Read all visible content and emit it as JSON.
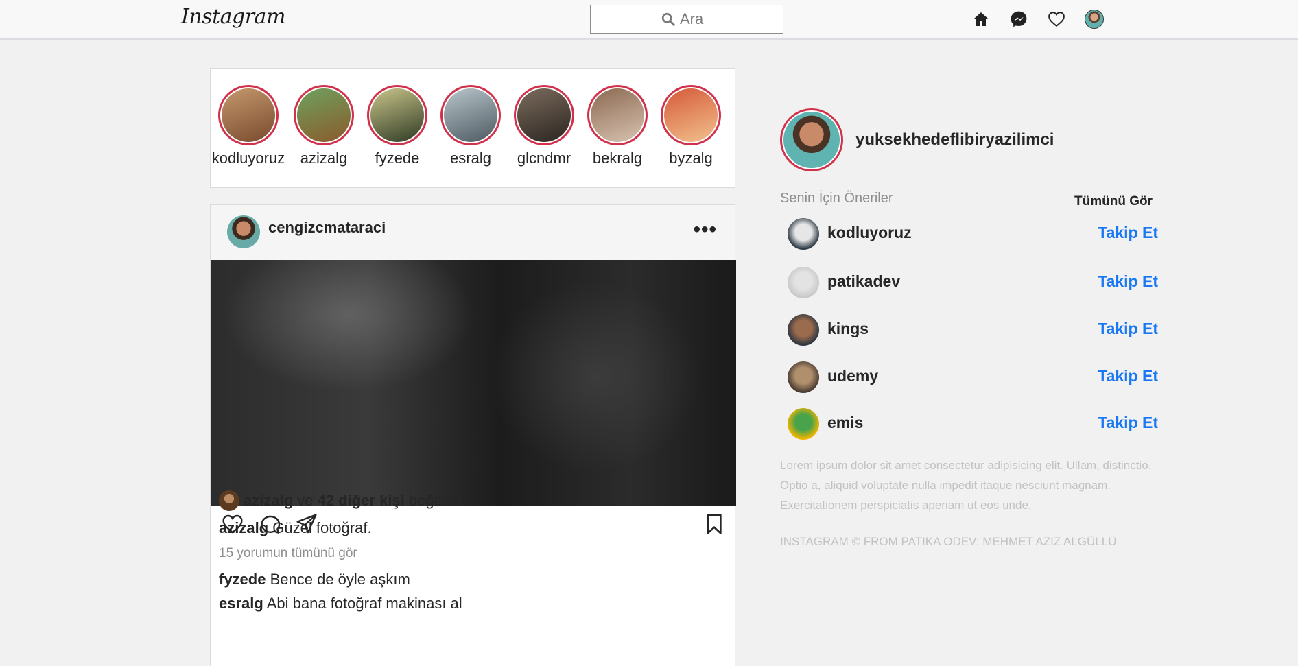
{
  "nav": {
    "logo": "Instagram",
    "search_placeholder": "Ara",
    "icons": [
      "home-icon",
      "messenger-icon",
      "heart-icon",
      "profile-avatar"
    ]
  },
  "stories": [
    {
      "label": "kodluyoruz",
      "colors": [
        "#c4986c",
        "#7a4a2e"
      ]
    },
    {
      "label": "azizalg",
      "colors": [
        "#6ea15e",
        "#8b5a2b"
      ]
    },
    {
      "label": "fyzede",
      "colors": [
        "#c9c48a",
        "#2f3b24"
      ]
    },
    {
      "label": "esralg",
      "colors": [
        "#b8c6cc",
        "#4d5a61"
      ]
    },
    {
      "label": "glcndmr",
      "colors": [
        "#7b6b5c",
        "#2b2521"
      ]
    },
    {
      "label": "bekralg",
      "colors": [
        "#8c6a52",
        "#d7c2b0"
      ]
    },
    {
      "label": "byzalg",
      "colors": [
        "#d55a3a",
        "#f2c18c"
      ]
    }
  ],
  "post": {
    "username": "cengizcmataraci",
    "more": "•••",
    "likes": {
      "liker": "azizalg",
      "connector": "ve",
      "others": "42 diğer kişi",
      "suffix": "beğendi"
    },
    "caption": {
      "user": "azizalg",
      "text": "Güzel fotoğraf."
    },
    "view_comments": "15 yorumun tümünü gör",
    "comments": [
      {
        "user": "fyzede",
        "text": "Bence de öyle aşkım"
      },
      {
        "user": "esralg",
        "text": "Abi bana fotoğraf makinası al"
      }
    ]
  },
  "sidebar": {
    "profile_name": "yuksekhedeflibiryazilimci",
    "suggestions_title": "Senin İçin Öneriler",
    "see_all": "Tümünü Gör",
    "follow_label": "Takip Et",
    "suggestions": [
      {
        "name": "kodluyoruz",
        "colors": [
          "#e6e6e6",
          "#2d3a44"
        ]
      },
      {
        "name": "patikadev",
        "colors": [
          "#e3e3e3",
          "#c9c9c9"
        ]
      },
      {
        "name": "kings",
        "colors": [
          "#9b6b4e",
          "#2f3640"
        ]
      },
      {
        "name": "udemy",
        "colors": [
          "#b08f6c",
          "#4a3b32"
        ]
      },
      {
        "name": "emis",
        "colors": [
          "#49a34a",
          "#f2b500"
        ]
      }
    ],
    "lorem": "Lorem ipsum dolor sit amet consectetur adipisicing elit. Ullam, distinctio. Optio a, aliquid voluptate nulla impedit itaque nesciunt magnam. Exercitationem perspiciatis aperiam ut eos unde.",
    "footer": "INSTAGRAM © FROM PATIKA ODEV: MEHMET AZİZ ALGÜLLÜ"
  }
}
